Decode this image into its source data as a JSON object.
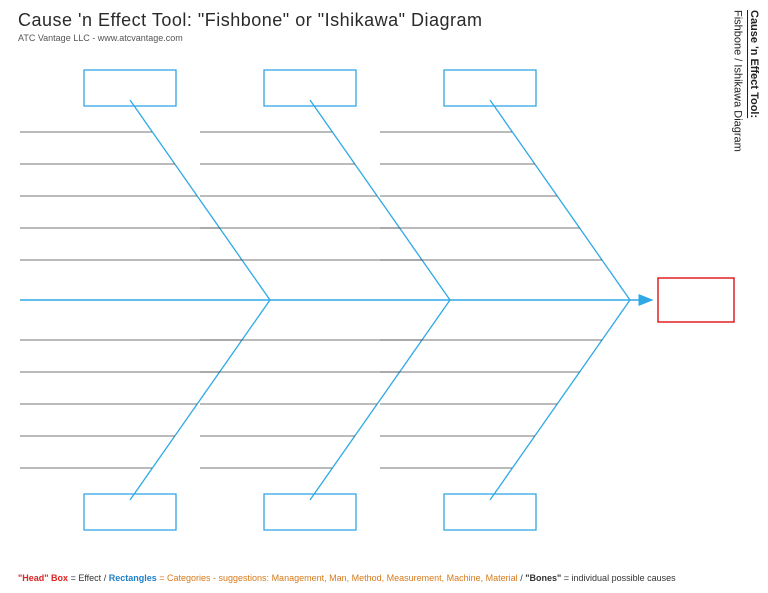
{
  "header": {
    "title": "Cause 'n Effect Tool:   \"Fishbone\" or \"Ishikawa\"  Diagram",
    "attribution": "ATC Vantage LLC - www.atcvantage.com"
  },
  "side": {
    "line1": "Cause 'n Effect Tool:",
    "line2": "Fishbone / Ishikawa Diagram"
  },
  "diagram": {
    "type": "fishbone",
    "spine_color": "#2fa8e6",
    "head_color": "#e02020",
    "category_box_color": "#2fa8e6",
    "bone_line_color": "#4a4a4a",
    "head": {
      "label": "",
      "role": "Effect"
    },
    "categories_top": [
      {
        "label": "",
        "bones": [
          "",
          "",
          "",
          "",
          ""
        ]
      },
      {
        "label": "",
        "bones": [
          "",
          "",
          "",
          "",
          ""
        ]
      },
      {
        "label": "",
        "bones": [
          "",
          "",
          "",
          "",
          ""
        ]
      }
    ],
    "categories_bottom": [
      {
        "label": "",
        "bones": [
          "",
          "",
          "",
          "",
          ""
        ]
      },
      {
        "label": "",
        "bones": [
          "",
          "",
          "",
          "",
          ""
        ]
      },
      {
        "label": "",
        "bones": [
          "",
          "",
          "",
          "",
          ""
        ]
      }
    ],
    "suggested_categories": [
      "Management",
      "Man",
      "Method",
      "Measurement",
      "Machine",
      "Material"
    ]
  },
  "legend": {
    "head_label": "\"Head\" Box",
    "head_def": "= Effect",
    "rect_label": "Rectangles",
    "rect_def_prefix": "= Categories -  suggestions: ",
    "rect_def_list": "Management, Man, Method, Measurement, Machine, Material",
    "bones_label": "\"Bones\"",
    "bones_def": "= individual possible causes",
    "sep": "  /  "
  }
}
